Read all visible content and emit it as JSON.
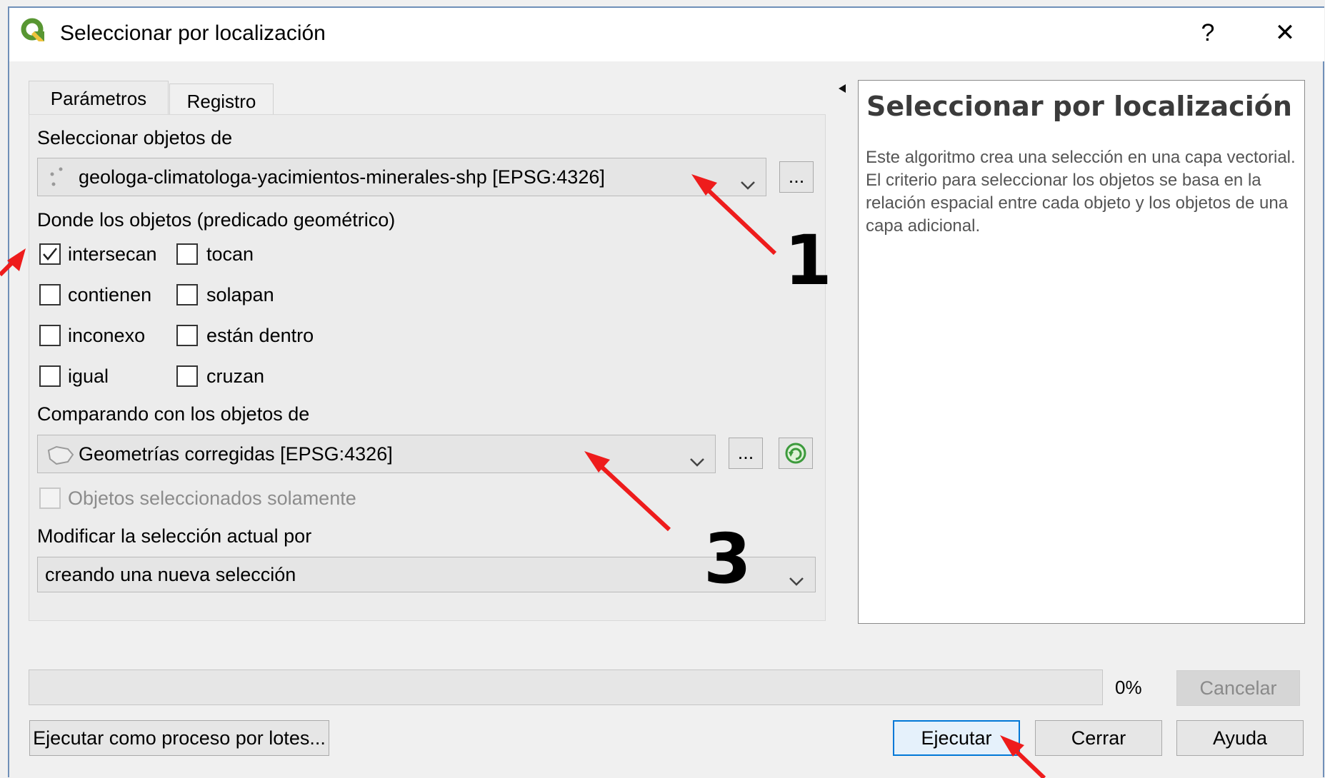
{
  "window": {
    "title": "Seleccionar por localización",
    "help_glyph": "?",
    "close_glyph": "✕"
  },
  "tabs": [
    {
      "label": "Parámetros"
    },
    {
      "label": "Registro"
    }
  ],
  "params": {
    "input_label": "Seleccionar objetos de",
    "input_value": "geologa-climatologa-yacimientos-minerales-shp [EPSG:4326]",
    "predicate_label": "Donde los objetos (predicado geométrico)",
    "predicates": [
      {
        "label": "intersecan",
        "checked": true
      },
      {
        "label": "tocan",
        "checked": false
      },
      {
        "label": "contienen",
        "checked": false
      },
      {
        "label": "solapan",
        "checked": false
      },
      {
        "label": "inconexo",
        "checked": false
      },
      {
        "label": "están dentro",
        "checked": false
      },
      {
        "label": "igual",
        "checked": false
      },
      {
        "label": "cruzan",
        "checked": false
      }
    ],
    "compare_label": "Comparando con los objetos de",
    "compare_value": "Geometrías corregidas [EPSG:4326]",
    "selected_only_label": "Objetos seleccionados solamente",
    "modify_label": "Modificar la selección actual por",
    "modify_value": "creando una nueva selección",
    "browse_label": "..."
  },
  "help": {
    "title": "Seleccionar por localización",
    "body": "Este algoritmo crea una selección en una capa vectorial. El criterio para seleccionar los objetos se basa en la relación espacial entre cada objeto y los objetos de una capa adicional."
  },
  "progress": {
    "value": 0,
    "text": "0%"
  },
  "buttons": {
    "cancel": "Cancelar",
    "batch": "Ejecutar como proceso por lotes...",
    "run": "Ejecutar",
    "close": "Cerrar",
    "help": "Ayuda"
  },
  "annotations": {
    "num1": "1",
    "num3": "3"
  },
  "colors": {
    "accent": "#0078d7",
    "arrow": "#ee1c1c",
    "qgis_green": "#589632",
    "qgis_yellow": "#f0c33c"
  }
}
